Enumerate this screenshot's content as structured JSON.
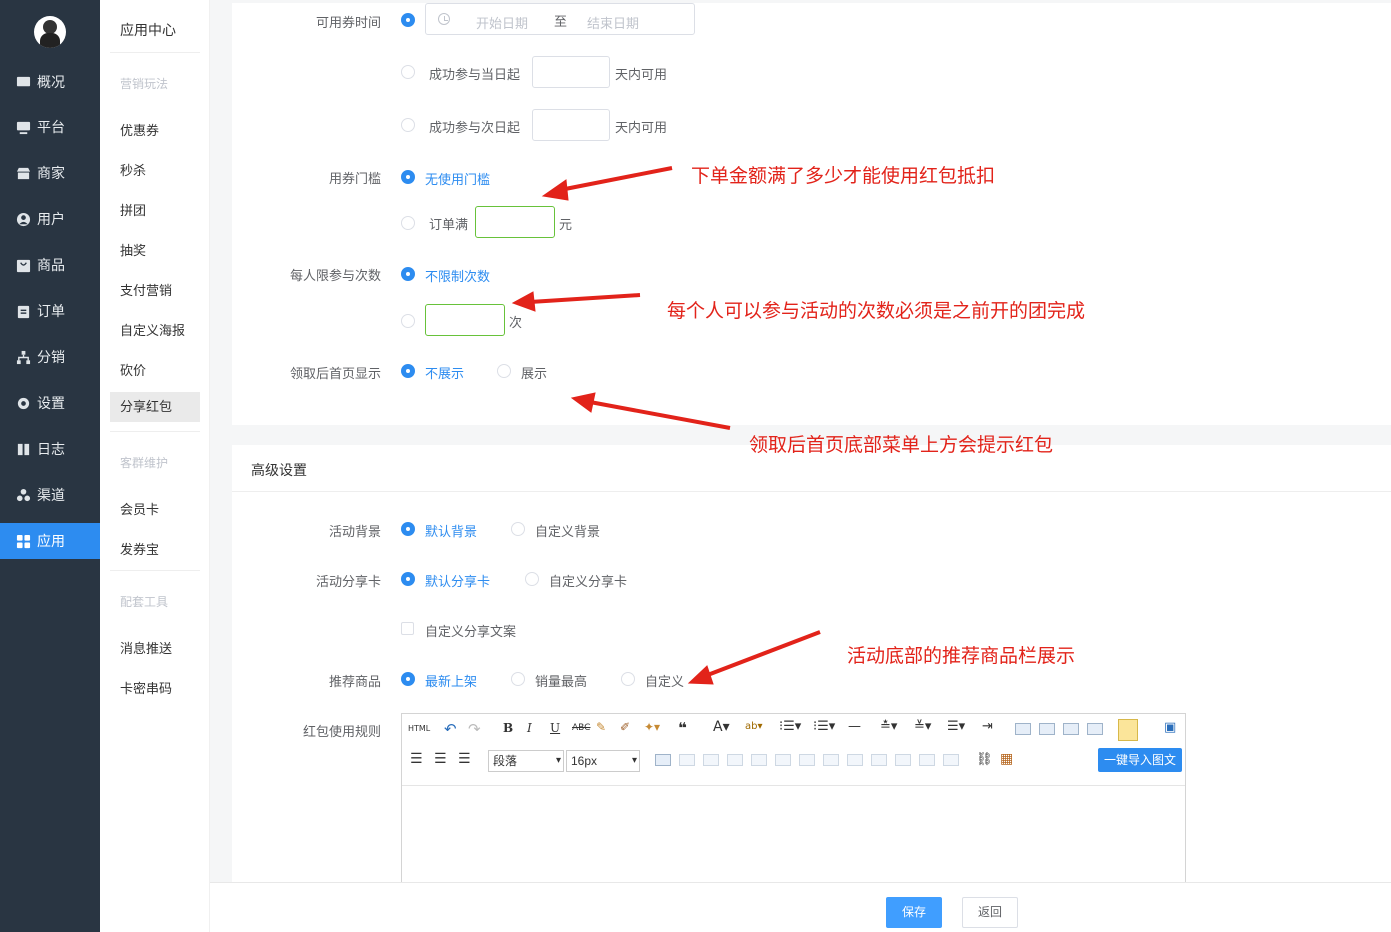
{
  "nav": {
    "items": [
      {
        "label": "概况",
        "icon": "dashboard-icon"
      },
      {
        "label": "平台",
        "icon": "monitor-icon"
      },
      {
        "label": "商家",
        "icon": "store-icon"
      },
      {
        "label": "用户",
        "icon": "user-icon"
      },
      {
        "label": "商品",
        "icon": "bag-icon"
      },
      {
        "label": "订单",
        "icon": "clipboard-icon"
      },
      {
        "label": "分销",
        "icon": "network-icon"
      },
      {
        "label": "设置",
        "icon": "gear-icon"
      },
      {
        "label": "日志",
        "icon": "book-icon"
      },
      {
        "label": "渠道",
        "icon": "channels-icon"
      },
      {
        "label": "应用",
        "icon": "apps-icon"
      }
    ]
  },
  "subnav": {
    "title": "应用中心",
    "groups": [
      "营销玩法",
      "客群维护",
      "配套工具"
    ],
    "items": [
      "优惠券",
      "秒杀",
      "拼团",
      "抽奖",
      "支付营销",
      "自定义海报",
      "砍价",
      "分享红包",
      "会员卡",
      "发券宝",
      "消息推送",
      "卡密串码"
    ]
  },
  "form": {
    "coupon_time": {
      "label": "可用券时间",
      "start_placeholder": "开始日期",
      "separator": "至",
      "end_placeholder": "结束日期",
      "opt_same_day": "成功参与当日起",
      "opt_next_day": "成功参与次日起",
      "days_unit": "天内可用"
    },
    "threshold": {
      "label": "用券门槛",
      "opt_none": "无使用门槛",
      "opt_order": "订单满",
      "unit": "元"
    },
    "limit": {
      "label": "每人限参与次数",
      "opt_unlimited": "不限制次数",
      "unit": "次"
    },
    "homepage": {
      "label": "领取后首页显示",
      "opt_hide": "不展示",
      "opt_show": "展示"
    }
  },
  "advanced": {
    "title": "高级设置",
    "background": {
      "label": "活动背景",
      "opt_default": "默认背景",
      "opt_custom": "自定义背景"
    },
    "share_card": {
      "label": "活动分享卡",
      "opt_default": "默认分享卡",
      "opt_custom": "自定义分享卡"
    },
    "custom_copy": "自定义分享文案",
    "recommend": {
      "label": "推荐商品",
      "opt_new": "最新上架",
      "opt_sales": "销量最高",
      "opt_custom": "自定义"
    },
    "rules_label": "红包使用规则"
  },
  "editor": {
    "html_btn": "HTML",
    "paragraph": "段落",
    "font_size": "16px",
    "import_btn": "一键导入图文"
  },
  "annotations": {
    "a1": "下单金额满了多少才能使用红包抵扣",
    "a2": "每个人可以参与活动的次数必须是之前开的团完成",
    "a3": "领取后首页底部菜单上方会提示红包",
    "a4": "活动底部的推荐商品栏展示"
  },
  "footer": {
    "save": "保存",
    "back": "返回"
  },
  "colors": {
    "accent": "#2d8cf0",
    "sidebar": "#293542",
    "annotation": "#e2231a"
  }
}
